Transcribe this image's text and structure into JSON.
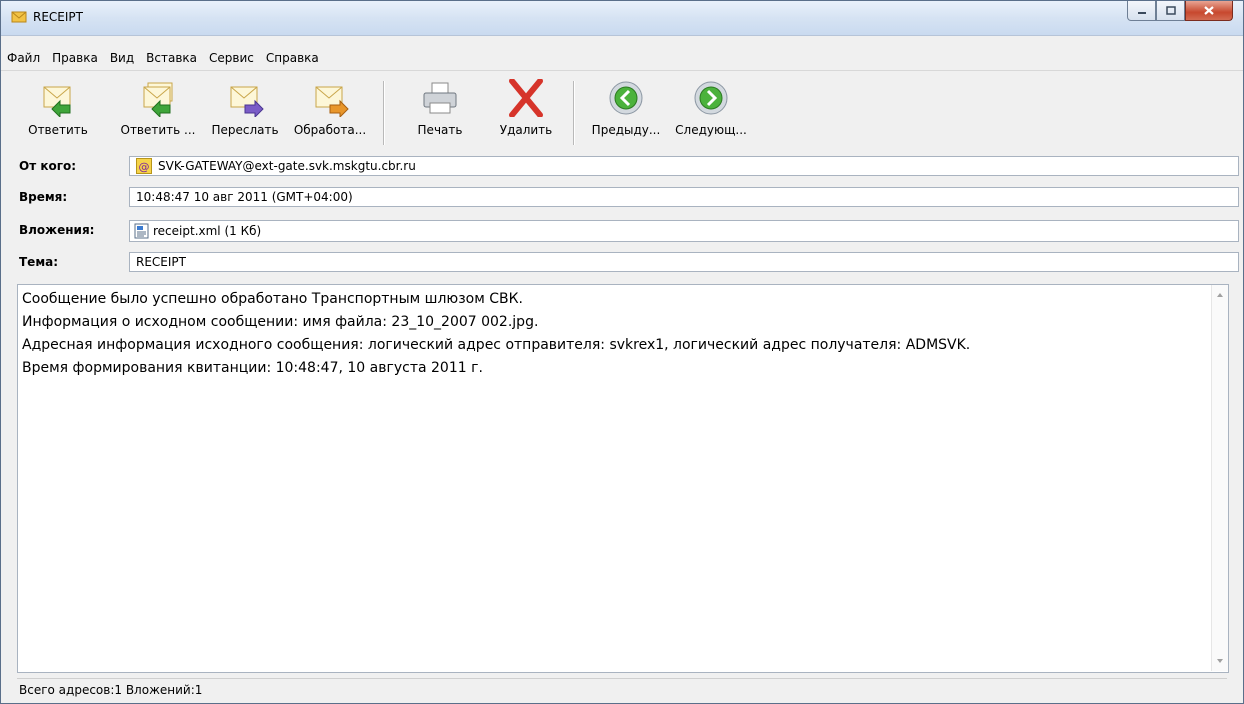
{
  "window": {
    "title": "RECEIPT",
    "icon": "envelope-icon"
  },
  "window_controls": [
    "minimize-icon",
    "maximize-icon",
    "close-icon"
  ],
  "menu": [
    "Файл",
    "Правка",
    "Вид",
    "Вставка",
    "Сервис",
    "Справка"
  ],
  "toolbar": {
    "reply": "Ответить",
    "reply_all": "Ответить ...",
    "forward": "Переслать",
    "process": "Обработа...",
    "print": "Печать",
    "delete": "Удалить",
    "prev": "Предыду...",
    "next": "Следующ..."
  },
  "header": {
    "from_label": "От кого:",
    "from_value": "SVK-GATEWAY@ext-gate.svk.mskgtu.cbr.ru",
    "time_label": "Время:",
    "time_value": "10:48:47 10 авг 2011 (GMT+04:00)",
    "attachments_label": "Вложения:",
    "attachment_value": "receipt.xml (1 Кб)",
    "subject_label": "Тема:",
    "subject_value": "RECEIPT"
  },
  "body": {
    "line1": "Сообщение было успешно обработано Транспортным шлюзом СВК.",
    "line2": "Информация о исходном сообщении: имя файла: 23_10_2007 002.jpg.",
    "line3": "Адресная информация исходного сообщения: логический адрес отправителя: svkrex1, логический адрес получателя: ADMSVK.",
    "line4": "Время формирования квитанции: 10:48:47, 10 августа 2011 г."
  },
  "status": {
    "text": "Всего адресов:1  Вложений:1"
  },
  "colors": {
    "accent_green": "#3fa53a",
    "delete_red": "#d6342a",
    "forward_purple": "#7a5cc7",
    "process_orange": "#e8962b"
  }
}
